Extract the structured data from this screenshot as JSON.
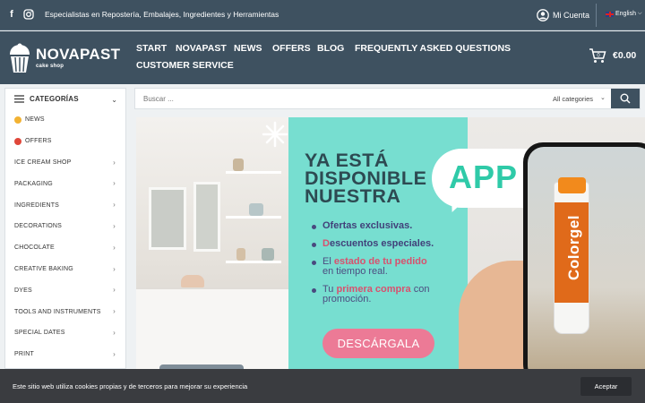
{
  "topbar": {
    "tagline": "Especialistas en Repostería, Embalajes, Ingredientes y Herramientas",
    "account": "Mi Cuenta",
    "language": "English",
    "icons": [
      "facebook-icon",
      "instagram-icon",
      "user-circle-icon",
      "uk-flag-icon",
      "chevron-down-icon"
    ]
  },
  "logo": {
    "brand": "NOVAPAST",
    "sub": "cake shop"
  },
  "nav": [
    "START",
    "NOVAPAST",
    "NEWS",
    "OFFERS",
    "BLOG",
    "FREQUENTLY ASKED QUESTIONS",
    "CUSTOMER SERVICE"
  ],
  "cart": {
    "amount": "€0.00",
    "count": "0"
  },
  "categories": {
    "title": "CATEGORÍAS",
    "items": [
      {
        "label": "NEWS",
        "icon": "new-badge-icon",
        "submenu": false
      },
      {
        "label": "OFFERS",
        "icon": "offer-badge-icon",
        "submenu": false
      },
      {
        "label": "ICE CREAM SHOP",
        "submenu": true
      },
      {
        "label": "PACKAGING",
        "submenu": true
      },
      {
        "label": "INGREDIENTS",
        "submenu": true
      },
      {
        "label": "DECORATIONS",
        "submenu": true
      },
      {
        "label": "CHOCOLATE",
        "submenu": true
      },
      {
        "label": "CREATIVE BAKING",
        "submenu": true
      },
      {
        "label": "DYES",
        "submenu": true
      },
      {
        "label": "TOOLS AND INSTRUMENTS",
        "submenu": true
      },
      {
        "label": "SPECIAL DATES",
        "submenu": true
      },
      {
        "label": "PRINT",
        "submenu": true
      }
    ]
  },
  "search": {
    "placeholder": "Buscar ...",
    "category": "All categories"
  },
  "banner": {
    "line1": "YA ESTÁ",
    "line2": "DISPONIBLE",
    "line3": "NUESTRA",
    "app": "APP",
    "bullets": [
      {
        "bold": "Ofertas exclusivas.",
        "rest": ""
      },
      {
        "pink": "D",
        "bold": "escuentos especiales.",
        "rest": ""
      },
      {
        "plain": "El ",
        "bold": "estado de tu pedido",
        "rest2": "en tiempo real."
      },
      {
        "plain": "Tu ",
        "bold": "primera compra",
        "rest": " con",
        "rest2": "promoción."
      }
    ],
    "cta": "DESCÁRGALA",
    "product": "Colorgel"
  },
  "cookie": {
    "message": "Este sitio web utiliza cookies propias y de terceros para mejorar su experiencia",
    "accept": "Aceptar"
  },
  "colors": {
    "header": "#3e5160",
    "mint": "#77ded0",
    "app_green": "#2fcaa8",
    "cta_pink": "#ec7a96",
    "cookie_bg": "#3a3c40"
  }
}
